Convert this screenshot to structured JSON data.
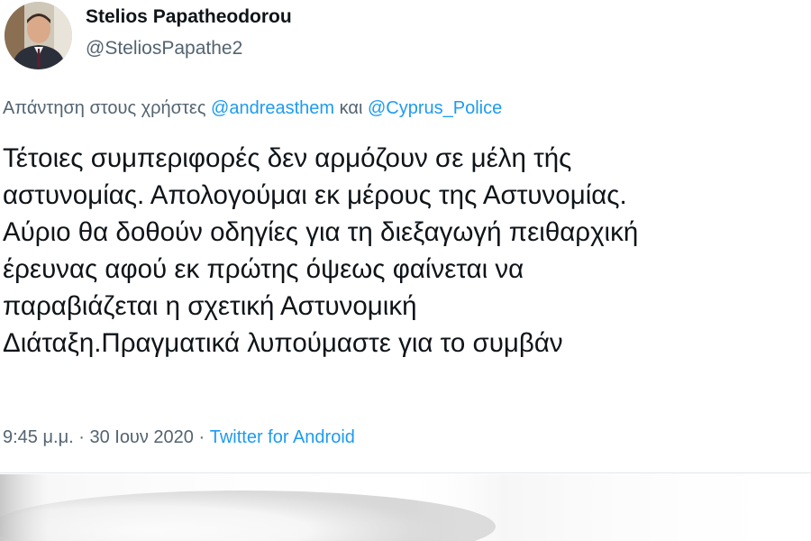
{
  "author": {
    "name": "Stelios Papatheodorou",
    "handle": "@SteliosPapathe2"
  },
  "reply": {
    "prefix": "Απάντηση στους χρήστες",
    "mention_1": "@andreasthem",
    "conjunction": "και",
    "mention_2": "@Cyprus_Police"
  },
  "tweet": {
    "lines": [
      "Τέτοιες συμπεριφορές δεν αρμόζουν σε μέλη τής",
      "αστυνομίας. Απολογούμαι εκ μέρους  της Αστυνομίας.",
      "Αύριο θα δοθούν οδηγίες για τη διεξαγωγή πειθαρχική",
      "έρευνας αφού εκ πρώτης όψεως φαίνεται να",
      "παραβιάζεται η σχετική Αστυνομική",
      "Διάταξη.Πραγματικά λυπούμαστε για το συμβάν"
    ]
  },
  "meta": {
    "time": "9:45 μ.μ.",
    "separator": "·",
    "date": "30 Ιουν 2020",
    "source": "Twitter for Android"
  },
  "colors": {
    "text": "#0f1419",
    "secondary": "#536471",
    "accent": "#1d9bf0",
    "divider": "#e1e8ed"
  }
}
